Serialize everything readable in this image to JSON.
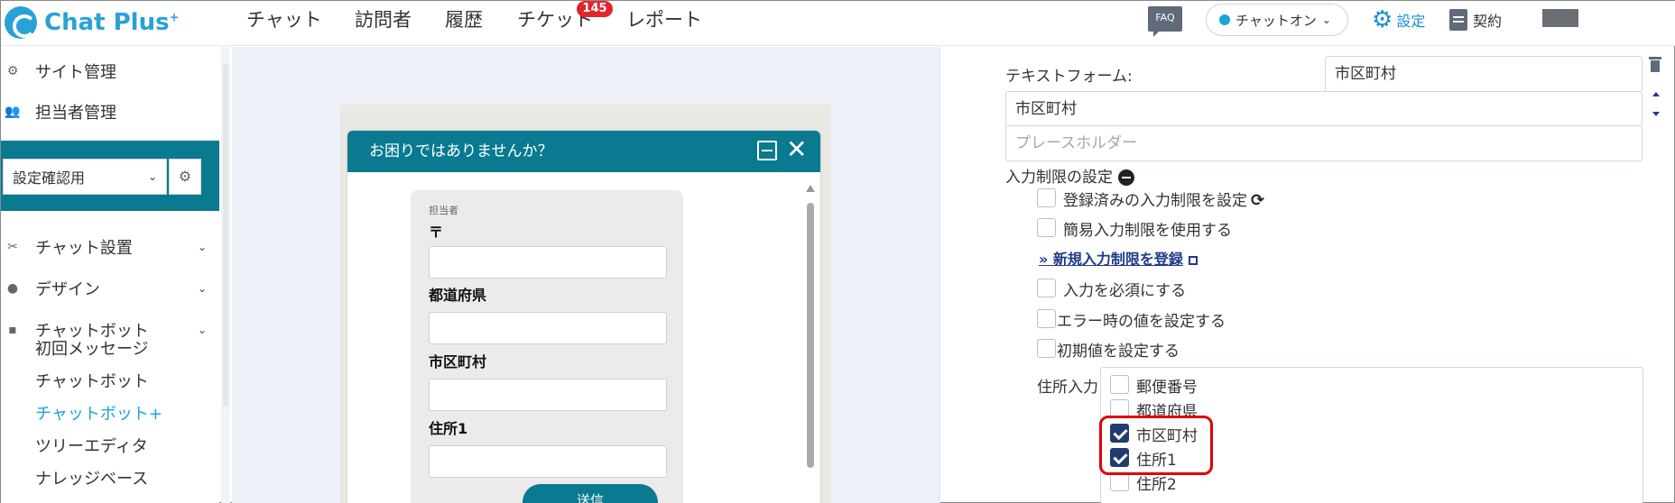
{
  "app": {
    "logo_text": "Chat Plus",
    "logo_sup": "+"
  },
  "topnav": {
    "items": [
      "チャット",
      "訪問者",
      "履歴",
      "チケット",
      "レポート"
    ],
    "ticket_badge": "145",
    "faq": "FAQ",
    "chat_status": "チャットオン",
    "settings": "設定",
    "contract": "契約"
  },
  "sidebar": {
    "site_admin": "サイト管理",
    "staff_admin": "担当者管理",
    "site_select": "設定確認用",
    "chat_setup": "チャット設置",
    "design": "デザイン",
    "chatbot": "チャットボット",
    "sub_items": [
      "初回メッセージ",
      "チャットボット",
      "チャットボット+",
      "ツリーエディタ",
      "ナレッジベース"
    ],
    "active_sub": "チャットボット+"
  },
  "preview": {
    "title": "お困りではありませんか？",
    "agent_label": "担当者",
    "fields": [
      "〒",
      "都道府県",
      "市区町村",
      "住所1"
    ],
    "send": "送信"
  },
  "settings_panel": {
    "text_form_label": "テキストフォーム:",
    "text_form_value": "市区町村",
    "label_value": "市区町村",
    "placeholder": "プレースホルダー",
    "input_restriction": "入力制限の設定",
    "options": [
      {
        "label": "登録済みの入力制限を設定",
        "checked": false
      },
      {
        "label": "簡易入力制限を使用する",
        "checked": false
      }
    ],
    "new_restriction_link": "» 新規入力制限を登録",
    "options2": [
      {
        "label": "入力を必須にする",
        "checked": false
      },
      {
        "label": "エラー時の値を設定する",
        "checked": false
      },
      {
        "label": "初期値を設定する",
        "checked": false
      }
    ],
    "address_input_label": "住所入力",
    "address_options": [
      {
        "label": "郵便番号",
        "checked": false
      },
      {
        "label": "都道府県",
        "checked": false
      },
      {
        "label": "市区町村",
        "checked": true
      },
      {
        "label": "住所1",
        "checked": true
      },
      {
        "label": "住所2",
        "checked": false
      }
    ]
  },
  "colors": {
    "brand": "#2aa0d8",
    "header_teal": "#097a90",
    "active_link": "#18a4dc",
    "checkbox_checked": "#213a70",
    "highlight": "#e00000"
  }
}
